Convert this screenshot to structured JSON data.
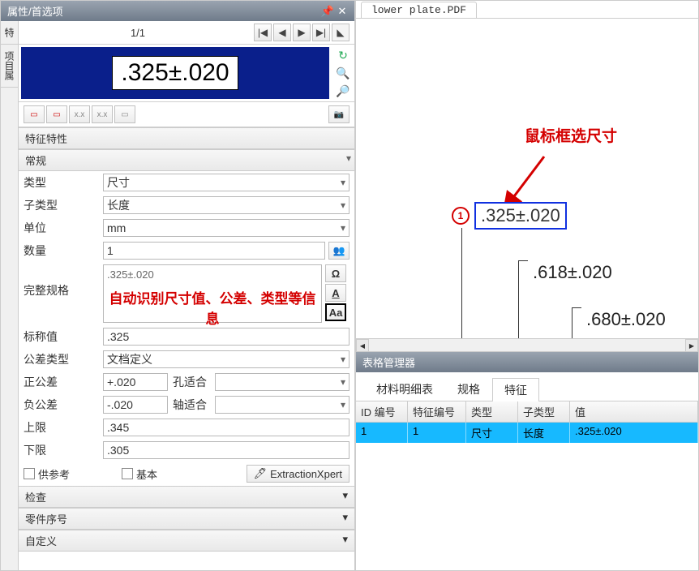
{
  "panel_title": "属性/首选项",
  "side_tabs": [
    "特",
    "项目属"
  ],
  "pager": {
    "label": "1/1"
  },
  "preview": {
    "value": ".325±.020"
  },
  "section": {
    "char_props": "特征特性",
    "general": "常规"
  },
  "form": {
    "type_label": "类型",
    "type_value": "尺寸",
    "subtype_label": "子类型",
    "subtype_value": "长度",
    "unit_label": "单位",
    "unit_value": "mm",
    "qty_label": "数量",
    "qty_value": "1",
    "fullspec_label": "完整规格",
    "fullspec_value": ".325±.020",
    "annotation": "自动识别尺寸值、公差、类型等信息",
    "nominal_label": "标称值",
    "nominal_value": ".325",
    "toltype_label": "公差类型",
    "toltype_value": "文档定义",
    "ptol_label": "正公差",
    "ptol_value": "+.020",
    "ptol2_label": "孔适合",
    "ntol_label": "负公差",
    "ntol_value": "-.020",
    "ntol2_label": "轴适合",
    "upper_label": "上限",
    "upper_value": ".345",
    "lower_label": "下限",
    "lower_value": ".305",
    "ref_label": "供参考",
    "basic_label": "基本",
    "ext_btn": "ExtractionXpert"
  },
  "collapse": {
    "inspection": "检查",
    "partseq": "零件序号",
    "custom": "自定义"
  },
  "spec_tools": {
    "omega": "Ω",
    "a_underline": "A",
    "aa_box": "Aa"
  },
  "doc_tab": "lower plate.PDF",
  "hint": "鼠标框选尺寸",
  "balloon_num": "1",
  "dims": {
    "d1": ".325±.020",
    "d2": ".618±.020",
    "d3": ".680±.020"
  },
  "mgr_title": "表格管理器",
  "mgr_tabs": {
    "bom": "材料明细表",
    "table": "规格",
    "feature": "特征"
  },
  "grid": {
    "headers": {
      "id": "ID 编号",
      "featid": "特征编号",
      "type": "类型",
      "subtype": "子类型",
      "value": "值"
    },
    "rows": [
      {
        "id": "1",
        "featid": "1",
        "type": "尺寸",
        "subtype": "长度",
        "value": ".325±.020"
      }
    ]
  },
  "chart_data": null
}
